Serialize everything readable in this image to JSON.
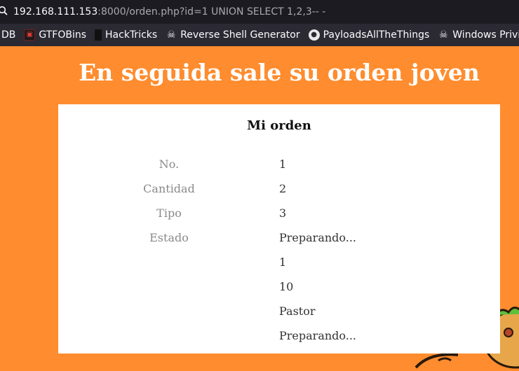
{
  "browser": {
    "url_host": "192.168.111.153",
    "url_rest": ":8000/orden.php?id=1 UNION SELECT 1,2,3-- -",
    "bookmarks": [
      {
        "label": "DB",
        "icon": "none"
      },
      {
        "label": "GTFOBins",
        "icon": "gtfobins-icon"
      },
      {
        "label": "HackTricks",
        "icon": "hacktricks-icon"
      },
      {
        "label": "Reverse Shell Generator",
        "icon": "skull-icon"
      },
      {
        "label": "PayloadsAllTheThings",
        "icon": "github-icon"
      },
      {
        "label": "Windows Privilege",
        "icon": "skull-icon"
      }
    ]
  },
  "page": {
    "title": "En seguida sale su orden joven",
    "background_color": "#ff8c2e"
  },
  "order": {
    "heading": "Mi orden",
    "labels": [
      "No.",
      "Cantidad",
      "Tipo",
      "Estado"
    ],
    "values": [
      "1",
      "2",
      "3",
      "Preparando...",
      "1",
      "10",
      "Pastor",
      "Preparando..."
    ]
  }
}
